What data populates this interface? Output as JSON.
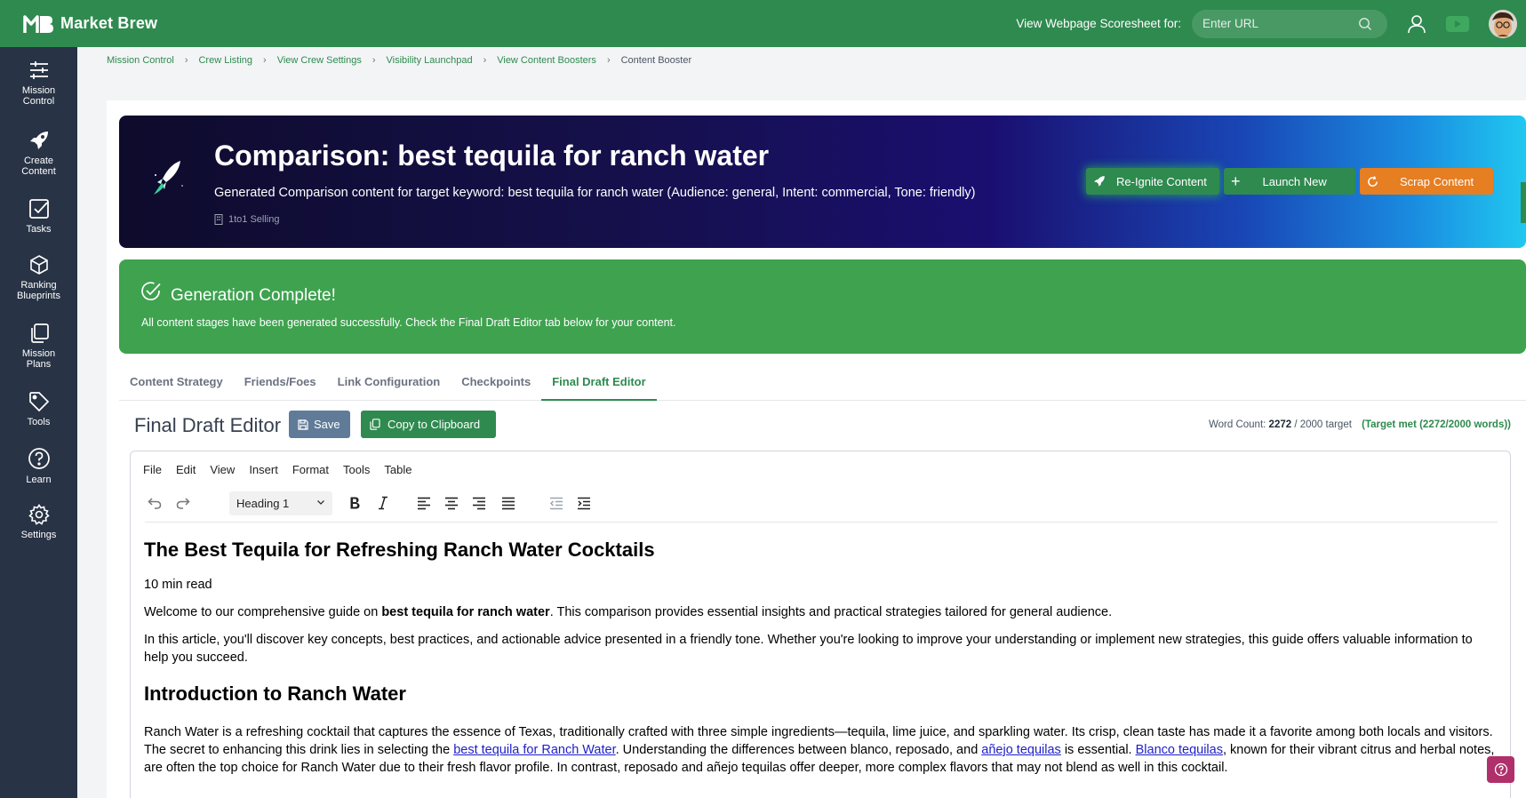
{
  "app": {
    "name": "Market Brew"
  },
  "header": {
    "scoresheet_label": "View Webpage Scoresheet for:",
    "url_placeholder": "Enter URL"
  },
  "sidebar": {
    "items": [
      {
        "label_1": "Mission",
        "label_2": "Control",
        "icon": "sliders-icon"
      },
      {
        "label_1": "Create",
        "label_2": "Content",
        "icon": "rocket-icon"
      },
      {
        "label_1": "Tasks",
        "label_2": "",
        "icon": "checkbox-icon"
      },
      {
        "label_1": "Ranking",
        "label_2": "Blueprints",
        "icon": "cube-icon"
      },
      {
        "label_1": "Mission",
        "label_2": "Plans",
        "icon": "copy-icon"
      },
      {
        "label_1": "Tools",
        "label_2": "",
        "icon": "tag-icon"
      },
      {
        "label_1": "Learn",
        "label_2": "",
        "icon": "help-circle-icon"
      },
      {
        "label_1": "Settings",
        "label_2": "",
        "icon": "gear-icon"
      }
    ]
  },
  "breadcrumb": [
    "Mission Control",
    "Crew Listing",
    "View Crew Settings",
    "Visibility Launchpad",
    "View Content Boosters",
    "Content Booster"
  ],
  "hero": {
    "title": "Comparison: best tequila for ranch water",
    "subtitle": "Generated Comparison content for target keyword: best tequila for ranch water (Audience: general, Intent: commercial, Tone: friendly)",
    "org": "1to1 Selling",
    "buttons": {
      "reignite": "Re-Ignite Content",
      "launch": "Launch New",
      "scrap": "Scrap Content"
    }
  },
  "success": {
    "title": "Generation Complete!",
    "message": "All content stages have been generated successfully. Check the Final Draft Editor tab below for your content."
  },
  "tabs": [
    "Content Strategy",
    "Friends/Foes",
    "Link Configuration",
    "Checkpoints",
    "Final Draft Editor"
  ],
  "active_tab": "Final Draft Editor",
  "editor_header": {
    "title": "Final Draft Editor",
    "save": "Save",
    "copy": "Copy to Clipboard",
    "word_count_label": "Word Count:",
    "word_count": "2272",
    "word_target": "/ 2000 target",
    "target_met": "(Target met (2272/2000 words))"
  },
  "editor": {
    "menu": [
      "File",
      "Edit",
      "View",
      "Insert",
      "Format",
      "Tools",
      "Table"
    ],
    "block_format": "Heading 1"
  },
  "document": {
    "h1": "The Best Tequila for Refreshing Ranch Water Cocktails",
    "read_time": "10 min read",
    "p1_pre": "Welcome to our comprehensive guide on ",
    "p1_bold": "best tequila for ranch water",
    "p1_post": ". This comparison provides essential insights and practical strategies tailored for general audience.",
    "p2": "In this article, you'll discover key concepts, best practices, and actionable advice presented in a friendly tone. Whether you're looking to improve your understanding or implement new strategies, this guide offers valuable information to help you succeed.",
    "h2": "Introduction to Ranch Water",
    "p3_a": "Ranch Water is a refreshing cocktail that captures the essence of Texas, traditionally crafted with three simple ingredients—tequila, lime juice, and sparkling water. Its crisp, clean taste has made it a favorite among both locals and visitors. The secret to enhancing this drink lies in selecting the ",
    "p3_link1": "best tequila for Ranch Water",
    "p3_b": ". Understanding the differences between blanco, reposado, and ",
    "p3_link2": "añejo tequilas",
    "p3_c": " is essential. ",
    "p3_link3": "Blanco tequilas",
    "p3_d": ", known for their vibrant citrus and herbal notes, are often the top choice for Ranch Water due to their fresh flavor profile. In contrast, reposado and añejo tequilas offer deeper, more complex flavors that may not blend as well in this cocktail."
  }
}
